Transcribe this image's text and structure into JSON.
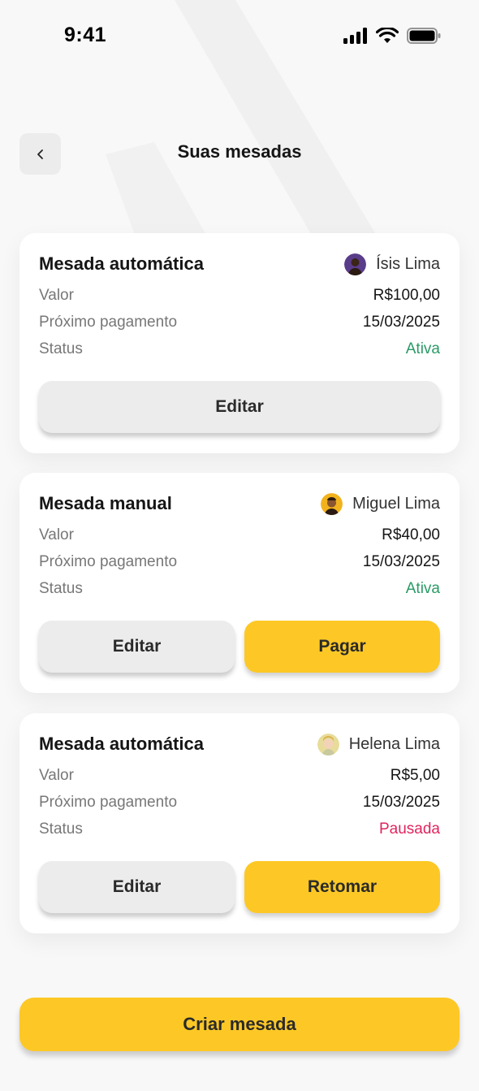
{
  "status_bar": {
    "time": "9:41"
  },
  "header": {
    "title": "Suas mesadas"
  },
  "labels": {
    "value": "Valor",
    "next_payment": "Próximo pagamento",
    "status": "Status"
  },
  "cards": [
    {
      "title": "Mesada automática",
      "user": "Ísis Lima",
      "value": "R$100,00",
      "next_payment": "15/03/2025",
      "status": "Ativa",
      "buttons": {
        "edit": "Editar"
      }
    },
    {
      "title": "Mesada manual",
      "user": "Miguel Lima",
      "value": "R$40,00",
      "next_payment": "15/03/2025",
      "status": "Ativa",
      "buttons": {
        "edit": "Editar",
        "primary": "Pagar"
      }
    },
    {
      "title": "Mesada automática",
      "user": "Helena Lima",
      "value": "R$5,00",
      "next_payment": "15/03/2025",
      "status": "Pausada",
      "buttons": {
        "edit": "Editar",
        "primary": "Retomar"
      }
    }
  ],
  "create_button": "Criar mesada",
  "colors": {
    "accent": "#fdc825",
    "status_active": "#2b9a66",
    "status_paused": "#e0245e",
    "button_gray": "#ececec"
  },
  "icons": [
    "back-chevron-icon",
    "signal-icon",
    "wifi-icon",
    "battery-icon"
  ]
}
